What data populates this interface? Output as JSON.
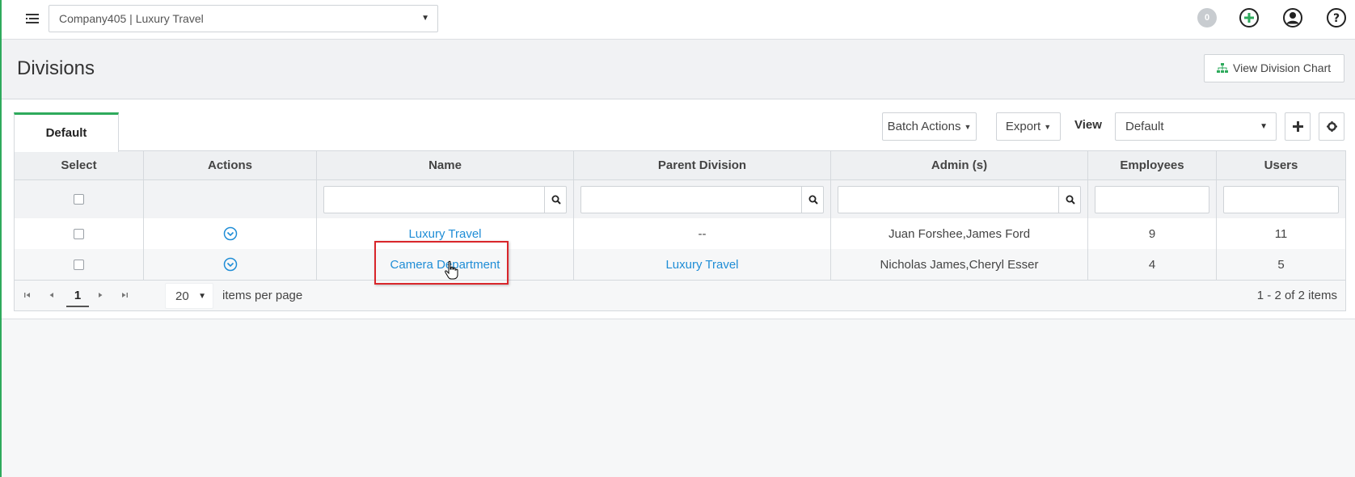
{
  "topbar": {
    "company": "Company405 | Luxury Travel",
    "notification_count": "0"
  },
  "header": {
    "title": "Divisions",
    "chart_button": "View Division Chart"
  },
  "toolbar": {
    "tab": "Default",
    "batch_actions": "Batch Actions",
    "export": "Export",
    "view_label": "View",
    "view_value": "Default"
  },
  "grid": {
    "columns": [
      "Select",
      "Actions",
      "Name",
      "Parent Division",
      "Admin (s)",
      "Employees",
      "Users"
    ],
    "rows": [
      {
        "name": "Luxury Travel",
        "parent": "--",
        "admins": "Juan Forshee,James Ford",
        "employees": "9",
        "users": "11"
      },
      {
        "name": "Camera Department",
        "parent": "Luxury Travel",
        "admins": "Nicholas James,Cheryl Esser",
        "employees": "4",
        "users": "5"
      }
    ]
  },
  "pager": {
    "current_page": "1",
    "per_page": "20",
    "per_page_label": "items per page",
    "range": "1 - 2 of 2 items"
  },
  "colors": {
    "accent": "#2eaa5c",
    "link": "#1f8dd6",
    "highlight": "#d9262b"
  }
}
